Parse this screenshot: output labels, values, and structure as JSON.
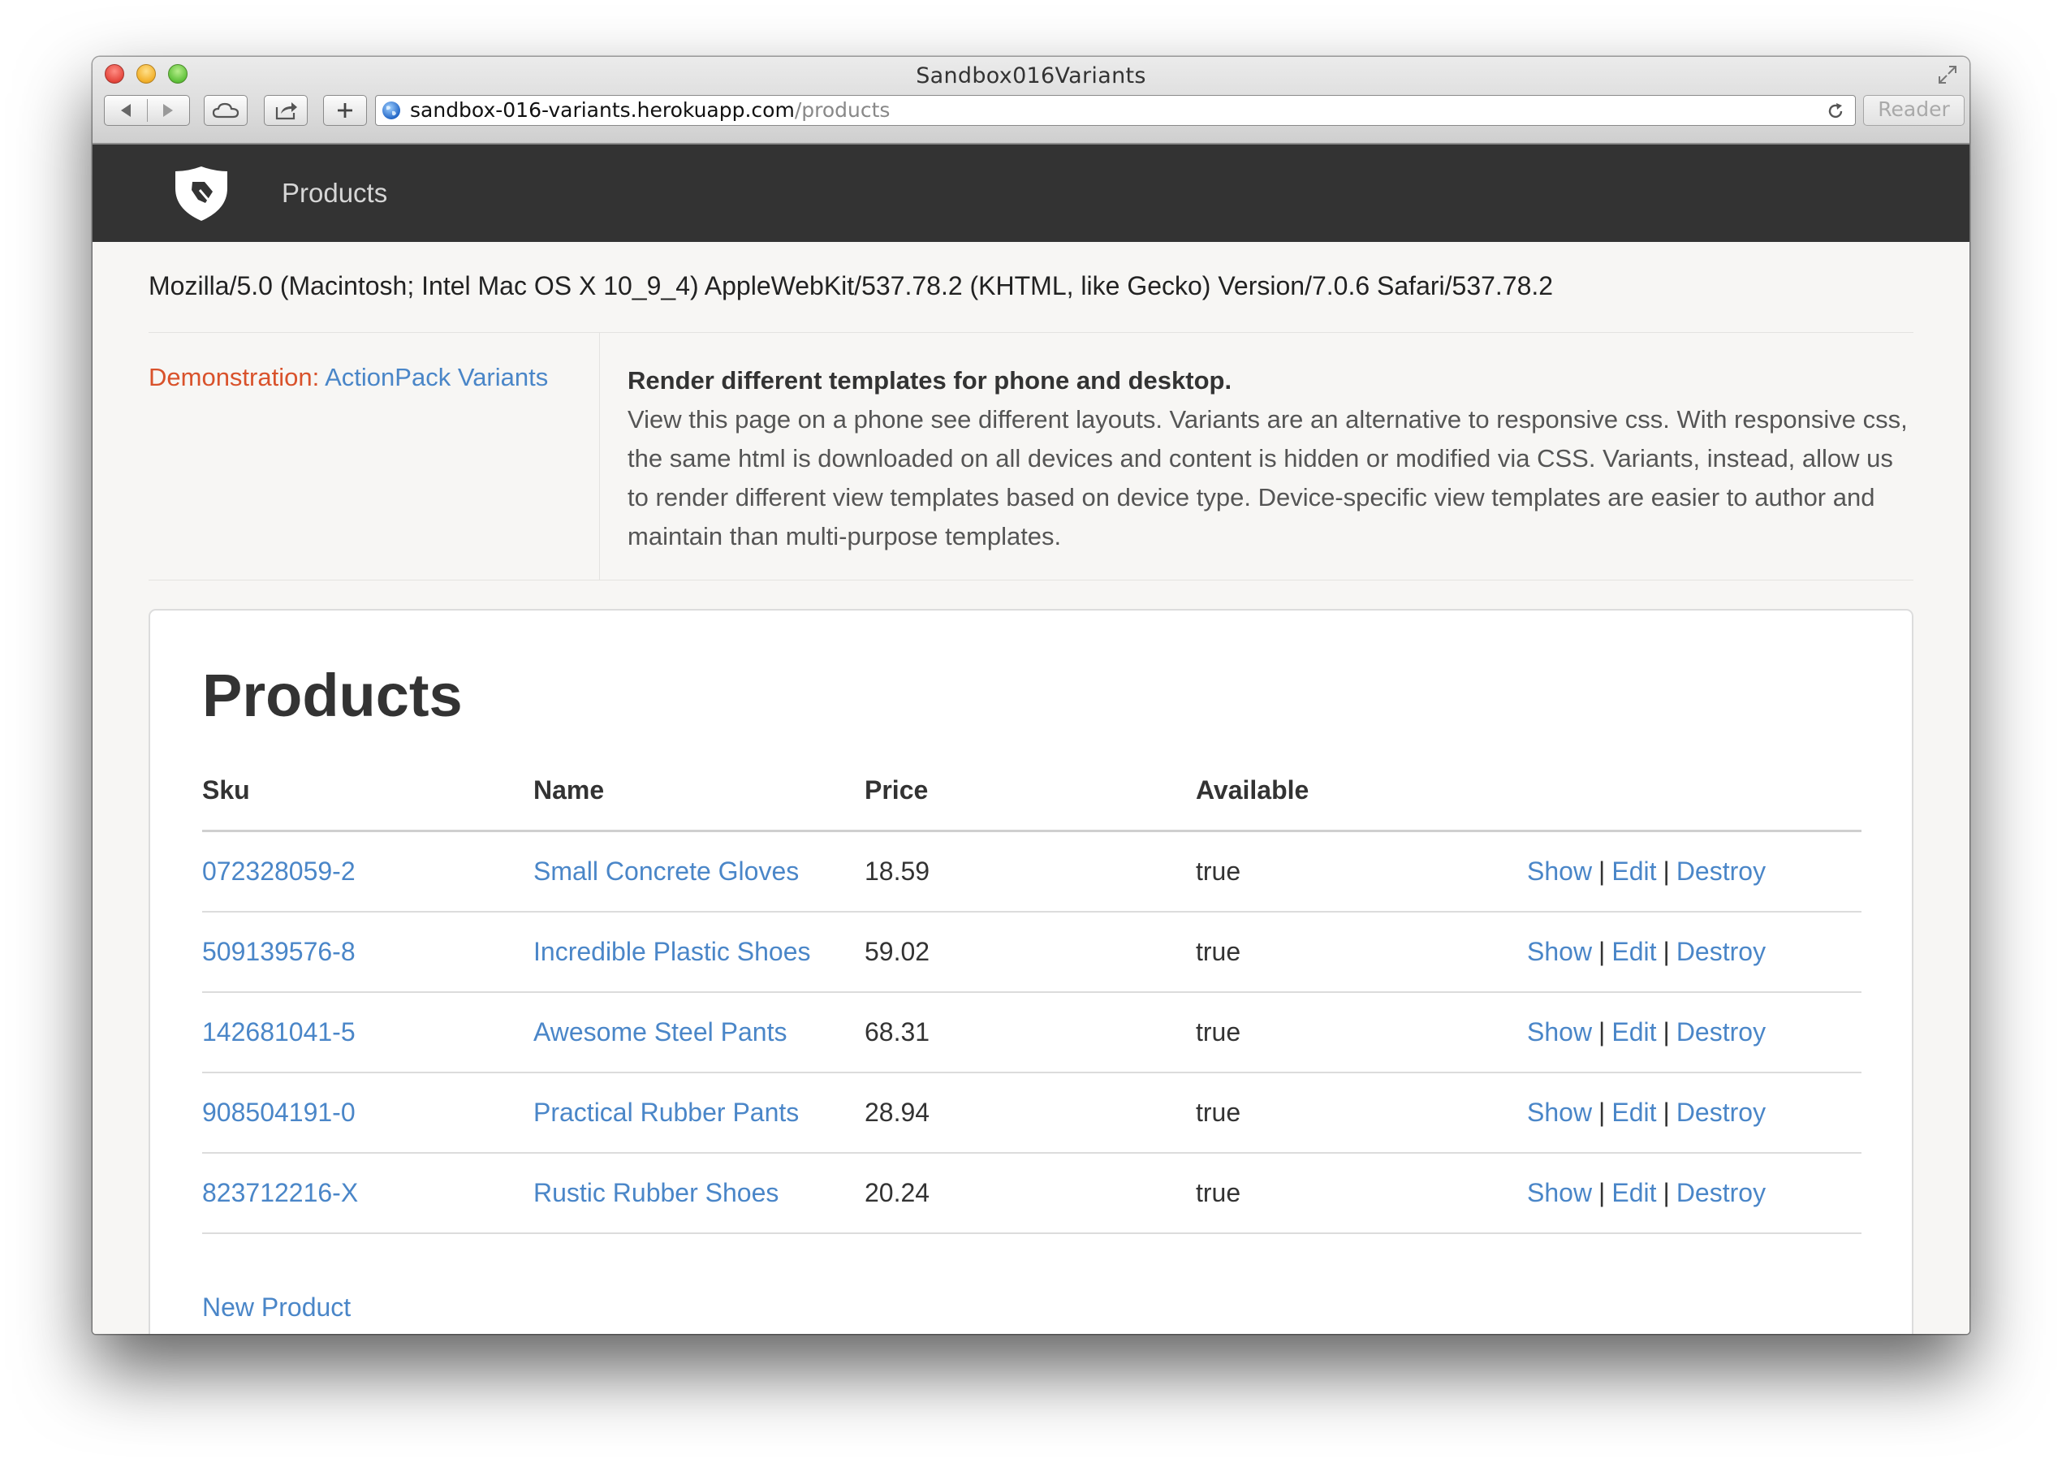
{
  "browser": {
    "window_title": "Sandbox016Variants",
    "url_host": "sandbox-016-variants.herokuapp.com",
    "url_path": "/products",
    "reader_label": "Reader"
  },
  "navbar": {
    "brand_icon": "shield-logo-icon",
    "products_link": "Products"
  },
  "user_agent": "Mozilla/5.0 (Macintosh; Intel Mac OS X 10_9_4) AppleWebKit/537.78.2 (KHTML, like Gecko) Version/7.0.6 Safari/537.78.2",
  "demo": {
    "label": "Demonstration:",
    "link": "ActionPack Variants",
    "title": "Render different templates for phone and desktop.",
    "body": "View this page on a phone see different layouts. Variants are an alternative to responsive css. With responsive css, the same html is downloaded on all devices and content is hidden or modified via CSS. Variants, instead, allow us to render different view templates based on device type. Device-specific view templates are easier to author and maintain than multi-purpose templates."
  },
  "products": {
    "heading": "Products",
    "columns": [
      "Sku",
      "Name",
      "Price",
      "Available"
    ],
    "rows": [
      {
        "sku": "072328059-2",
        "name": "Small Concrete Gloves",
        "price": "18.59",
        "available": "true"
      },
      {
        "sku": "509139576-8",
        "name": "Incredible Plastic Shoes",
        "price": "59.02",
        "available": "true"
      },
      {
        "sku": "142681041-5",
        "name": "Awesome Steel Pants",
        "price": "68.31",
        "available": "true"
      },
      {
        "sku": "908504191-0",
        "name": "Practical Rubber Pants",
        "price": "28.94",
        "available": "true"
      },
      {
        "sku": "823712216-X",
        "name": "Rustic Rubber Shoes",
        "price": "20.24",
        "available": "true"
      }
    ],
    "actions": {
      "show": "Show",
      "edit": "Edit",
      "destroy": "Destroy",
      "separator": "|"
    },
    "new_product": "New Product"
  },
  "colors": {
    "navbar_bg": "#333333",
    "link": "#4a86c8",
    "demo_label": "#d9522b",
    "page_bg": "#f7f6f4"
  }
}
